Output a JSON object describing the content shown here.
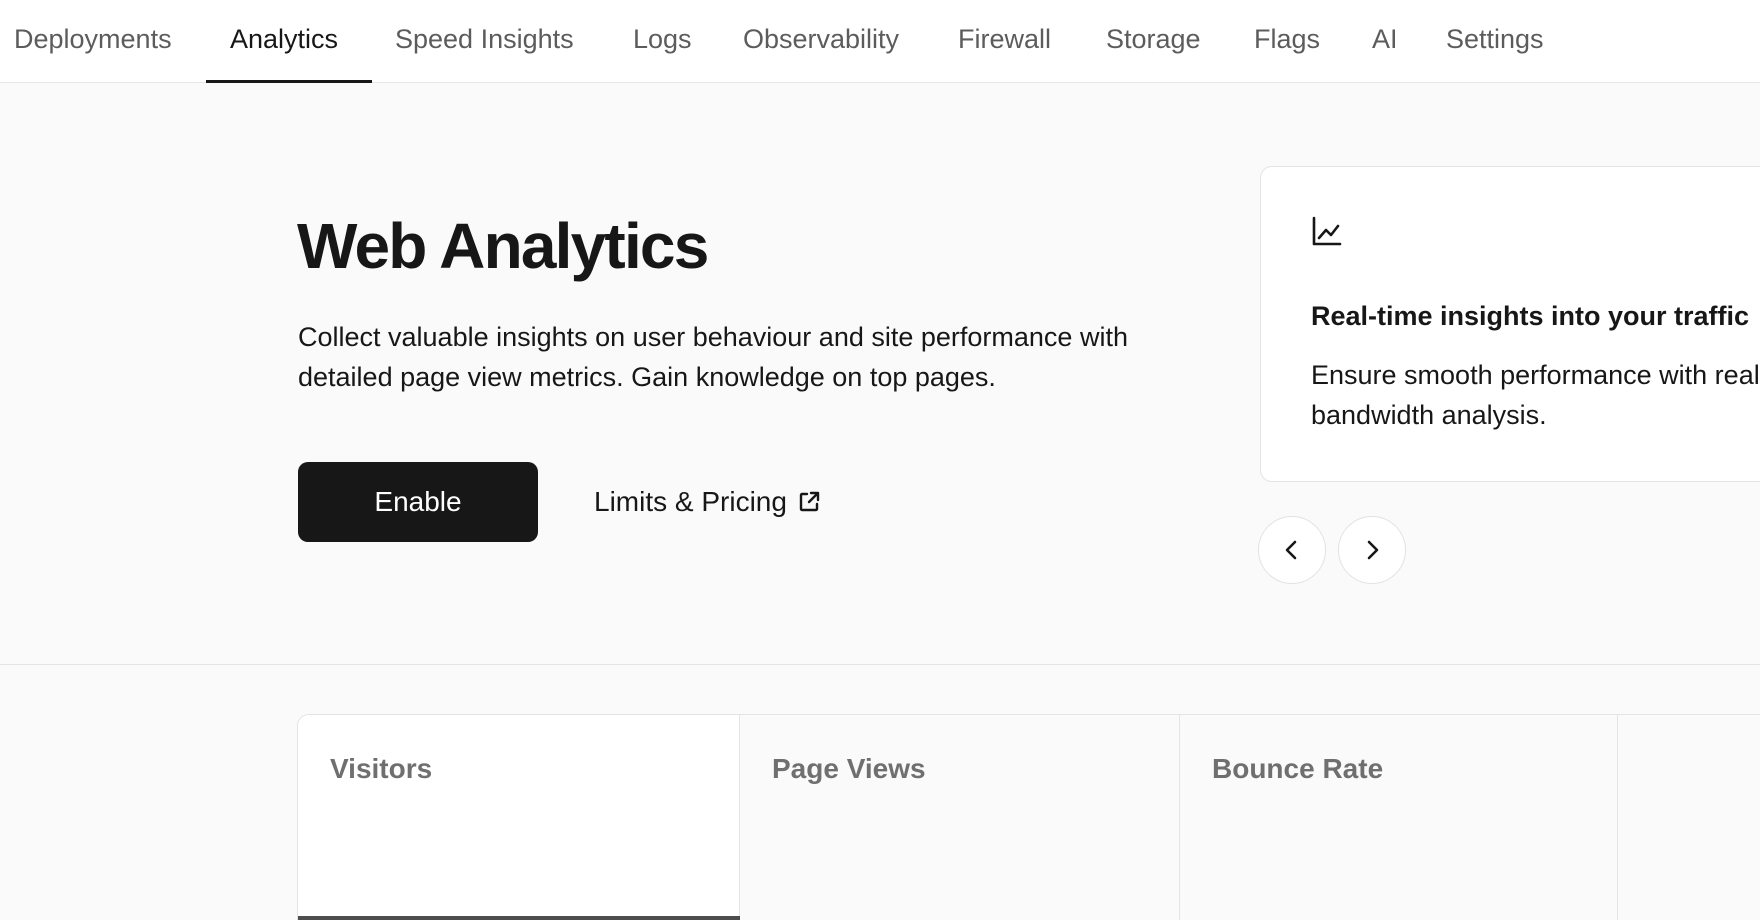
{
  "nav": {
    "tabs": [
      {
        "label": "Deployments"
      },
      {
        "label": "Analytics",
        "active": true
      },
      {
        "label": "Speed Insights"
      },
      {
        "label": "Logs"
      },
      {
        "label": "Observability"
      },
      {
        "label": "Firewall"
      },
      {
        "label": "Storage"
      },
      {
        "label": "Flags"
      },
      {
        "label": "AI"
      },
      {
        "label": "Settings"
      }
    ]
  },
  "hero": {
    "title": "Web Analytics",
    "description": "Collect valuable insights on user behaviour and site performance with detailed page view metrics. Gain knowledge on top pages.",
    "enable_label": "Enable",
    "pricing_label": "Limits & Pricing"
  },
  "feature_card": {
    "icon": "line-chart-icon",
    "title": "Real-time insights into your traffic",
    "description": "Ensure smooth performance with real-time bandwidth analysis."
  },
  "metrics": {
    "items": [
      {
        "label": "Visitors",
        "active": true
      },
      {
        "label": "Page Views"
      },
      {
        "label": "Bounce Rate"
      },
      {
        "label": ""
      }
    ]
  },
  "colors": {
    "primary": "#171717",
    "background": "#fafafa",
    "border": "#e4e4e4",
    "muted_text": "#6f6f6f"
  }
}
